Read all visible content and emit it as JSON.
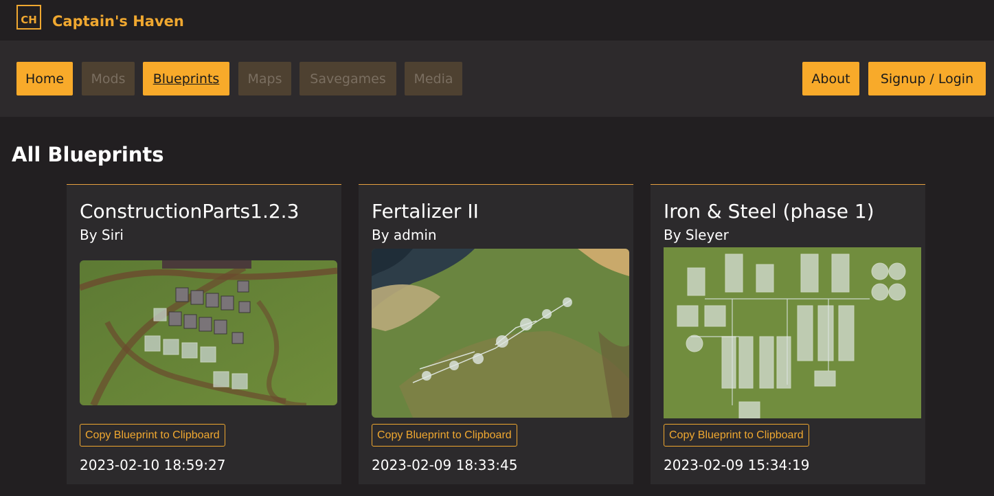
{
  "site": {
    "logo_text": "CH",
    "title": "Captain's Haven"
  },
  "nav": {
    "items": [
      {
        "label": "Home",
        "state": "active"
      },
      {
        "label": "Mods",
        "state": "inactive"
      },
      {
        "label": "Blueprints",
        "state": "current"
      },
      {
        "label": "Maps",
        "state": "inactive"
      },
      {
        "label": "Savegames",
        "state": "inactive"
      },
      {
        "label": "Media",
        "state": "inactive"
      }
    ],
    "right_items": [
      {
        "label": "About"
      },
      {
        "label": "Signup / Login"
      }
    ]
  },
  "page": {
    "title": "All Blueprints"
  },
  "blueprints": [
    {
      "title": "ConstructionParts1.2.3",
      "author": "By Siri",
      "copy_label": "Copy Blueprint to Clipboard",
      "date": "2023-02-10 18:59:27"
    },
    {
      "title": "Fertalizer II",
      "author": "By admin",
      "copy_label": "Copy Blueprint to Clipboard",
      "date": "2023-02-09 18:33:45"
    },
    {
      "title": "Iron & Steel (phase 1)",
      "author": "By Sleyer",
      "copy_label": "Copy Blueprint to Clipboard",
      "date": "2023-02-09 15:34:19"
    }
  ],
  "colors": {
    "accent": "#f8aa2a",
    "background": "#221f21",
    "card": "#2c2a2c",
    "inactive_button": "#4e4131"
  }
}
